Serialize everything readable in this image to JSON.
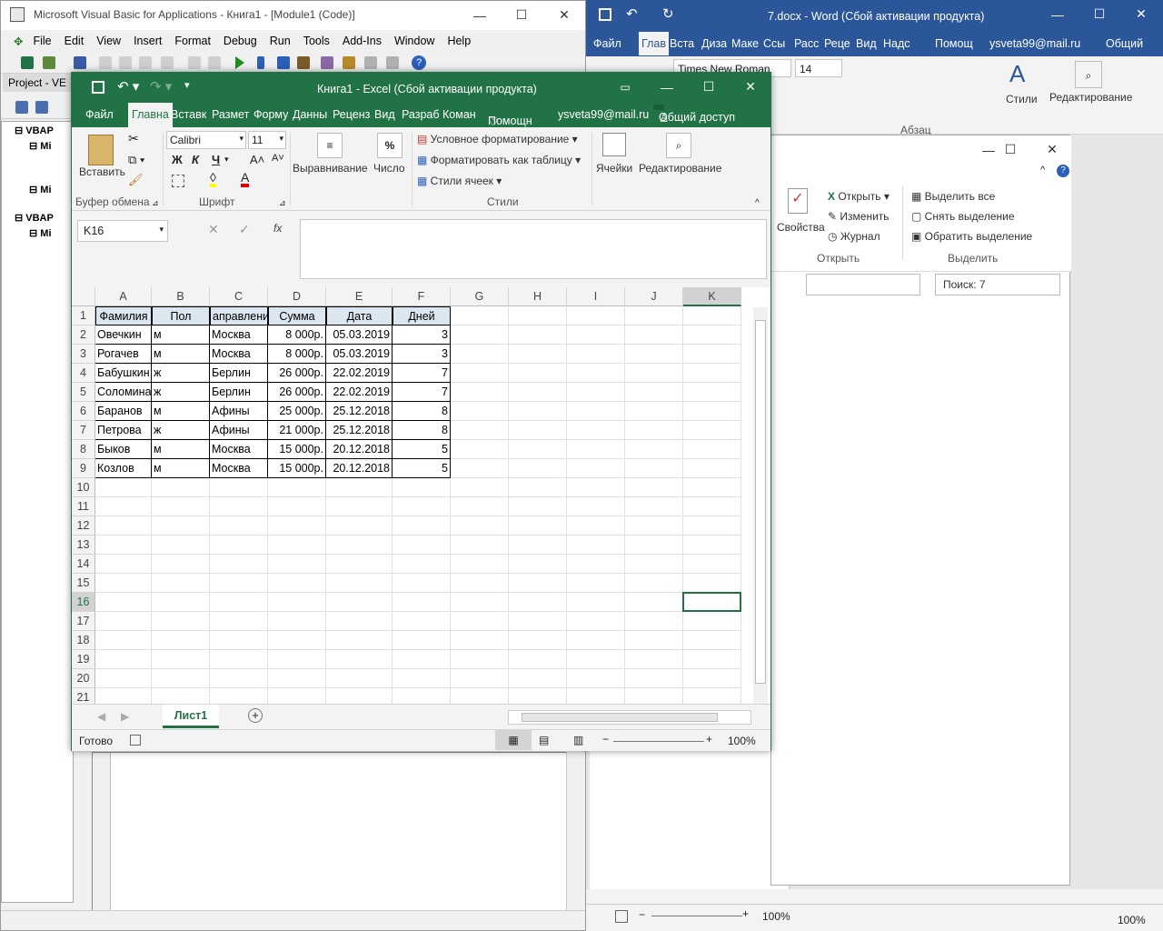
{
  "vba": {
    "title": "Microsoft Visual Basic for Applications - Книга1 - [Module1 (Code)]",
    "menu": [
      "File",
      "Edit",
      "View",
      "Insert",
      "Format",
      "Debug",
      "Run",
      "Tools",
      "Add-Ins",
      "Window",
      "Help"
    ],
    "project_title": "Project - VE",
    "tree": [
      "VBAP",
      "Mi",
      "Mi",
      "VBAP",
      "Mi"
    ]
  },
  "word": {
    "title": "7.docx - Word (Сбой активации продукта)",
    "tabs": [
      "Файл",
      "Глав",
      "Вста",
      "Диза",
      "Маке",
      "Ссы",
      "Расс",
      "Реце",
      "Вид",
      "Надс",
      "Помощ"
    ],
    "account": "ysveta99@mail.ru",
    "share": "Общий",
    "font": "Times New Roman",
    "font_size": "14",
    "styles": "Стили",
    "editing": "Редактирование",
    "paragraph": "Абзац",
    "zoom": "100%",
    "zoom2": "100%"
  },
  "dialog": {
    "props": "Свойства",
    "open": "Открыть",
    "edit": "Изменить",
    "journal": "Журнал",
    "open_group": "Открыть",
    "select_all": "Выделить все",
    "deselect": "Снять выделение",
    "invert": "Обратить выделение",
    "select_group": "Выделить",
    "search": "Поиск: 7"
  },
  "excel": {
    "title": "Книга1 - Excel (Сбой активации продукта)",
    "tabs": [
      "Файл",
      "Главна",
      "Вставк",
      "Размет",
      "Форму",
      "Данны",
      "Реценз",
      "Вид",
      "Разраб",
      "Коман",
      "Помощн"
    ],
    "account": "ysveta99@mail.ru",
    "share": "Общий доступ",
    "paste": "Вставить",
    "clipboard": "Буфер обмена",
    "font_name": "Calibri",
    "font_size": "11",
    "font_group": "Шрифт",
    "bold": "Ж",
    "italic": "К",
    "underline": "Ч",
    "alignment": "Выравнивание",
    "number": "Число",
    "cond_format": "Условное форматирование",
    "format_table": "Форматировать как таблицу",
    "cell_styles": "Стили ячеек",
    "styles_group": "Стили",
    "cells": "Ячейки",
    "editing": "Редактирование",
    "namebox": "K16",
    "columns": [
      "A",
      "B",
      "C",
      "D",
      "E",
      "F",
      "G",
      "H",
      "I",
      "J",
      "K"
    ],
    "rows": [
      "1",
      "2",
      "3",
      "4",
      "5",
      "6",
      "7",
      "8",
      "9",
      "10",
      "11",
      "12",
      "13",
      "14",
      "15",
      "16",
      "17",
      "18",
      "19",
      "20",
      "21"
    ],
    "table": {
      "header": [
        "Фамилия",
        "Пол",
        "аправлени",
        "Сумма",
        "Дата",
        "Дней"
      ],
      "rows": [
        [
          "Овечкин",
          "м",
          "Москва",
          "8 000р.",
          "05.03.2019",
          "3"
        ],
        [
          "Рогачев",
          "м",
          "Москва",
          "8 000р.",
          "05.03.2019",
          "3"
        ],
        [
          "Бабушкин",
          "ж",
          "Берлин",
          "26 000р.",
          "22.02.2019",
          "7"
        ],
        [
          "Соломина",
          "ж",
          "Берлин",
          "26 000р.",
          "22.02.2019",
          "7"
        ],
        [
          "Баранов",
          "м",
          "Афины",
          "25 000р.",
          "25.12.2018",
          "8"
        ],
        [
          "Петрова",
          "ж",
          "Афины",
          "21 000р.",
          "25.12.2018",
          "8"
        ],
        [
          "Быков",
          "м",
          "Москва",
          "15 000р.",
          "20.12.2018",
          "5"
        ],
        [
          "Козлов",
          "м",
          "Москва",
          "15 000р.",
          "20.12.2018",
          "5"
        ]
      ]
    },
    "sheet_tab": "Лист1",
    "status": "Готово",
    "zoom": "100%"
  }
}
